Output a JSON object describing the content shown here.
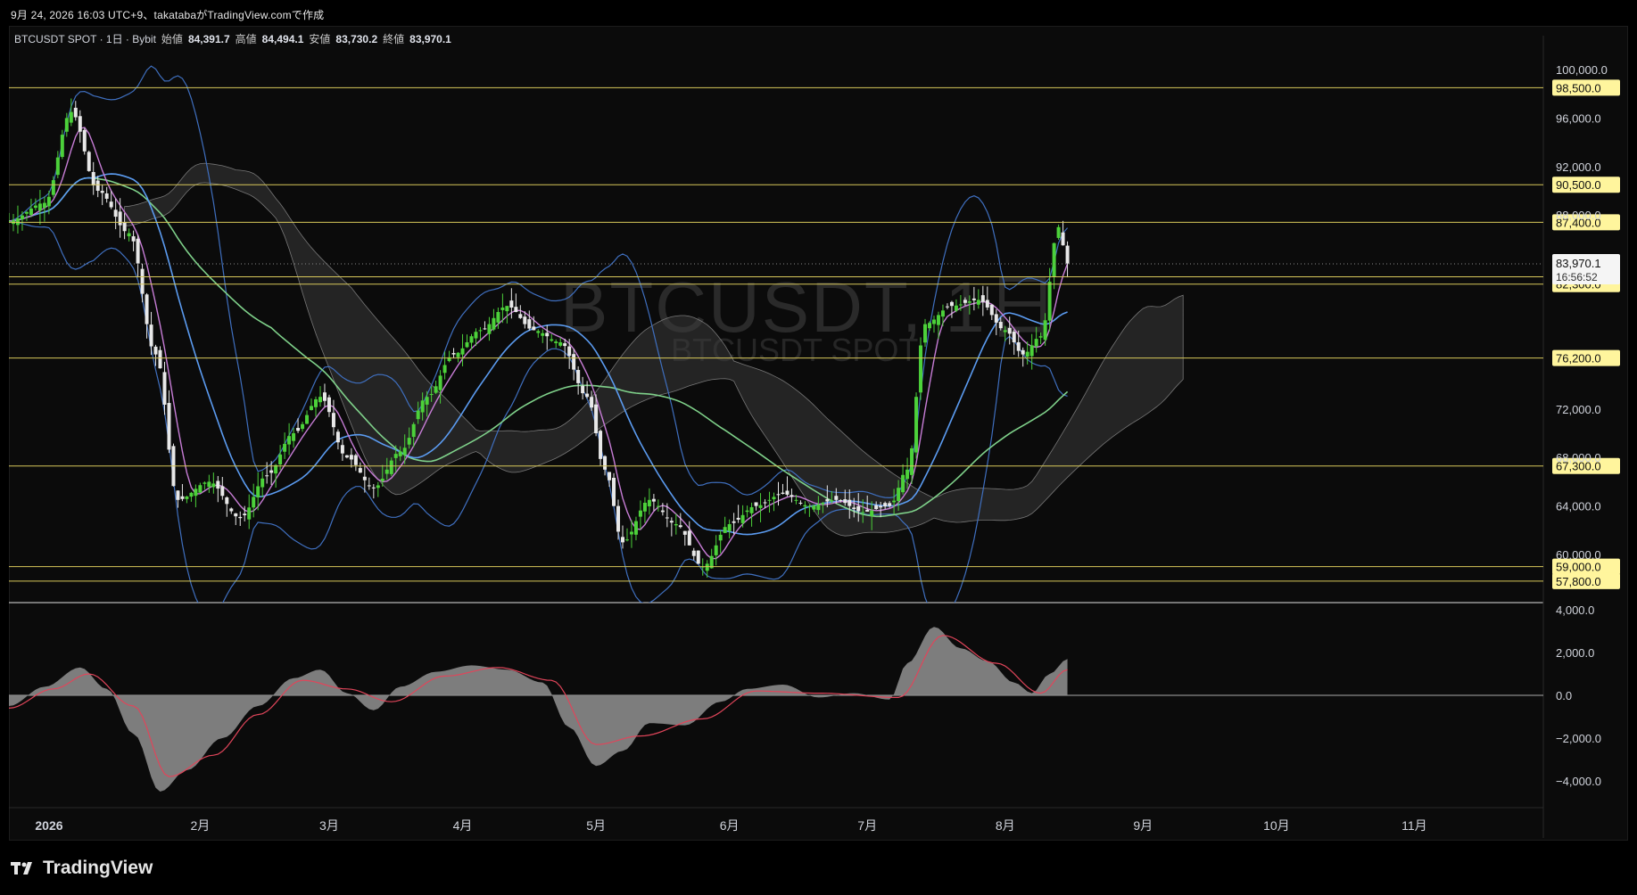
{
  "header": {
    "title": "9月 24, 2026 16:03 UTC+9、takatabaがTradingView.comで作成"
  },
  "symbol": {
    "name": "BTCUSDT SPOT · 1日 · Bybit",
    "open_label": "始値",
    "open": "84,391.7",
    "high_label": "高値",
    "high": "84,494.1",
    "low_label": "安値",
    "low": "83,730.2",
    "close_label": "終値",
    "close": "83,970.1"
  },
  "watermark": {
    "main": "BTCUSDT, 1日",
    "sub": "BTCUSDT SPOT"
  },
  "branding": {
    "logo_text": "TradingView"
  },
  "colors": {
    "bg": "#0b0b0b",
    "up": "#4cd13a",
    "down": "#e8e8e8",
    "level_line": "#d8c85a",
    "label_bg": "#fff59d",
    "bb": "#3f6fbf",
    "ma_fast": "#c77dd6",
    "ma_mid": "#5b9bf0",
    "ma_slow": "#7fd18a",
    "macd_line": "#e0455a",
    "hist": "#8a8a8a"
  },
  "chart_data": [
    {
      "type": "candlestick",
      "title": "",
      "price_scale": {
        "ticks": [
          "100,000.0",
          "96,000.0",
          "92,000.0",
          "88,000.0",
          "72,000.0",
          "68,000.0",
          "64,000.0",
          "60,000.0"
        ],
        "tick_values": [
          100000,
          96000,
          92000,
          88000,
          72000,
          68000,
          64000,
          60000
        ]
      },
      "x_axis": {
        "labels": [
          "2026",
          "2月",
          "3月",
          "4月",
          "5月",
          "6月",
          "7月",
          "8月",
          "9月",
          "10月",
          "11月"
        ]
      },
      "level_lines": [
        {
          "value": 98500,
          "label": "98,500.0"
        },
        {
          "value": 90500,
          "label": "90,500.0"
        },
        {
          "value": 87400,
          "label": "87,400.0"
        },
        {
          "value": 82900,
          "label": "82,900.0"
        },
        {
          "value": 82300,
          "label": "82,300.0"
        },
        {
          "value": 76200,
          "label": "76,200.0"
        },
        {
          "value": 67300,
          "label": "67,300.0"
        },
        {
          "value": 59000,
          "label": "59,000.0"
        },
        {
          "value": 57800,
          "label": "57,800.0"
        }
      ],
      "last_price": {
        "value": 83970.1,
        "label": "83,970.1",
        "countdown": "16:56:52"
      },
      "close_series": [
        {
          "day": 0,
          "close": 87500
        },
        {
          "day": 8,
          "close": 89000
        },
        {
          "day": 14,
          "close": 96500
        },
        {
          "day": 20,
          "close": 90000
        },
        {
          "day": 27,
          "close": 86500
        },
        {
          "day": 33,
          "close": 76500
        },
        {
          "day": 38,
          "close": 64500
        },
        {
          "day": 45,
          "close": 66000
        },
        {
          "day": 52,
          "close": 63000
        },
        {
          "day": 58,
          "close": 66500
        },
        {
          "day": 64,
          "close": 70000
        },
        {
          "day": 70,
          "close": 73000
        },
        {
          "day": 76,
          "close": 68000
        },
        {
          "day": 82,
          "close": 65500
        },
        {
          "day": 88,
          "close": 68500
        },
        {
          "day": 94,
          "close": 73000
        },
        {
          "day": 100,
          "close": 76500
        },
        {
          "day": 106,
          "close": 78500
        },
        {
          "day": 112,
          "close": 80500
        },
        {
          "day": 118,
          "close": 78500
        },
        {
          "day": 124,
          "close": 77500
        },
        {
          "day": 130,
          "close": 73000
        },
        {
          "day": 134,
          "close": 67000
        },
        {
          "day": 138,
          "close": 61000
        },
        {
          "day": 144,
          "close": 64500
        },
        {
          "day": 150,
          "close": 62500
        },
        {
          "day": 156,
          "close": 59000
        },
        {
          "day": 162,
          "close": 62500
        },
        {
          "day": 168,
          "close": 64000
        },
        {
          "day": 174,
          "close": 65000
        },
        {
          "day": 180,
          "close": 64000
        },
        {
          "day": 186,
          "close": 64500
        },
        {
          "day": 192,
          "close": 63500
        },
        {
          "day": 198,
          "close": 64000
        },
        {
          "day": 202,
          "close": 67000
        },
        {
          "day": 206,
          "close": 79000
        },
        {
          "day": 212,
          "close": 80500
        },
        {
          "day": 218,
          "close": 81000
        },
        {
          "day": 224,
          "close": 78500
        },
        {
          "day": 228,
          "close": 76500
        },
        {
          "day": 232,
          "close": 78000
        },
        {
          "day": 236,
          "close": 87000
        },
        {
          "day": 238,
          "close": 84000
        }
      ]
    },
    {
      "type": "area",
      "title": "",
      "y_ticks": [
        "4,000.0",
        "2,000.0",
        "0.0",
        "−2,000.0",
        "−4,000.0"
      ],
      "y_tick_values": [
        4000,
        2000,
        0,
        -2000,
        -4000
      ],
      "histogram": [
        {
          "day": 0,
          "value": -500
        },
        {
          "day": 8,
          "value": 400
        },
        {
          "day": 16,
          "value": 1300
        },
        {
          "day": 22,
          "value": 300
        },
        {
          "day": 28,
          "value": -1800
        },
        {
          "day": 34,
          "value": -4500
        },
        {
          "day": 40,
          "value": -3500
        },
        {
          "day": 48,
          "value": -2000
        },
        {
          "day": 56,
          "value": -500
        },
        {
          "day": 64,
          "value": 800
        },
        {
          "day": 70,
          "value": 1200
        },
        {
          "day": 76,
          "value": 100
        },
        {
          "day": 82,
          "value": -700
        },
        {
          "day": 88,
          "value": 400
        },
        {
          "day": 96,
          "value": 1100
        },
        {
          "day": 104,
          "value": 1400
        },
        {
          "day": 112,
          "value": 1200
        },
        {
          "day": 120,
          "value": 600
        },
        {
          "day": 126,
          "value": -1500
        },
        {
          "day": 132,
          "value": -3300
        },
        {
          "day": 138,
          "value": -2600
        },
        {
          "day": 144,
          "value": -1300
        },
        {
          "day": 152,
          "value": -1400
        },
        {
          "day": 160,
          "value": -300
        },
        {
          "day": 166,
          "value": 300
        },
        {
          "day": 174,
          "value": 500
        },
        {
          "day": 182,
          "value": -100
        },
        {
          "day": 190,
          "value": 100
        },
        {
          "day": 198,
          "value": -200
        },
        {
          "day": 202,
          "value": 1500
        },
        {
          "day": 208,
          "value": 3200
        },
        {
          "day": 214,
          "value": 2200
        },
        {
          "day": 220,
          "value": 1600
        },
        {
          "day": 226,
          "value": 600
        },
        {
          "day": 230,
          "value": 100
        },
        {
          "day": 234,
          "value": 1000
        },
        {
          "day": 238,
          "value": 1700
        }
      ],
      "signal": [
        {
          "day": 0,
          "value": -600
        },
        {
          "day": 10,
          "value": 300
        },
        {
          "day": 18,
          "value": 1000
        },
        {
          "day": 28,
          "value": -500
        },
        {
          "day": 36,
          "value": -3800
        },
        {
          "day": 46,
          "value": -2800
        },
        {
          "day": 56,
          "value": -900
        },
        {
          "day": 66,
          "value": 700
        },
        {
          "day": 76,
          "value": 300
        },
        {
          "day": 86,
          "value": -300
        },
        {
          "day": 98,
          "value": 900
        },
        {
          "day": 110,
          "value": 1300
        },
        {
          "day": 122,
          "value": 700
        },
        {
          "day": 132,
          "value": -2300
        },
        {
          "day": 142,
          "value": -1900
        },
        {
          "day": 156,
          "value": -1100
        },
        {
          "day": 168,
          "value": 200
        },
        {
          "day": 182,
          "value": 100
        },
        {
          "day": 200,
          "value": -100
        },
        {
          "day": 210,
          "value": 2800
        },
        {
          "day": 222,
          "value": 1500
        },
        {
          "day": 232,
          "value": 100
        },
        {
          "day": 238,
          "value": 1200
        }
      ]
    }
  ]
}
